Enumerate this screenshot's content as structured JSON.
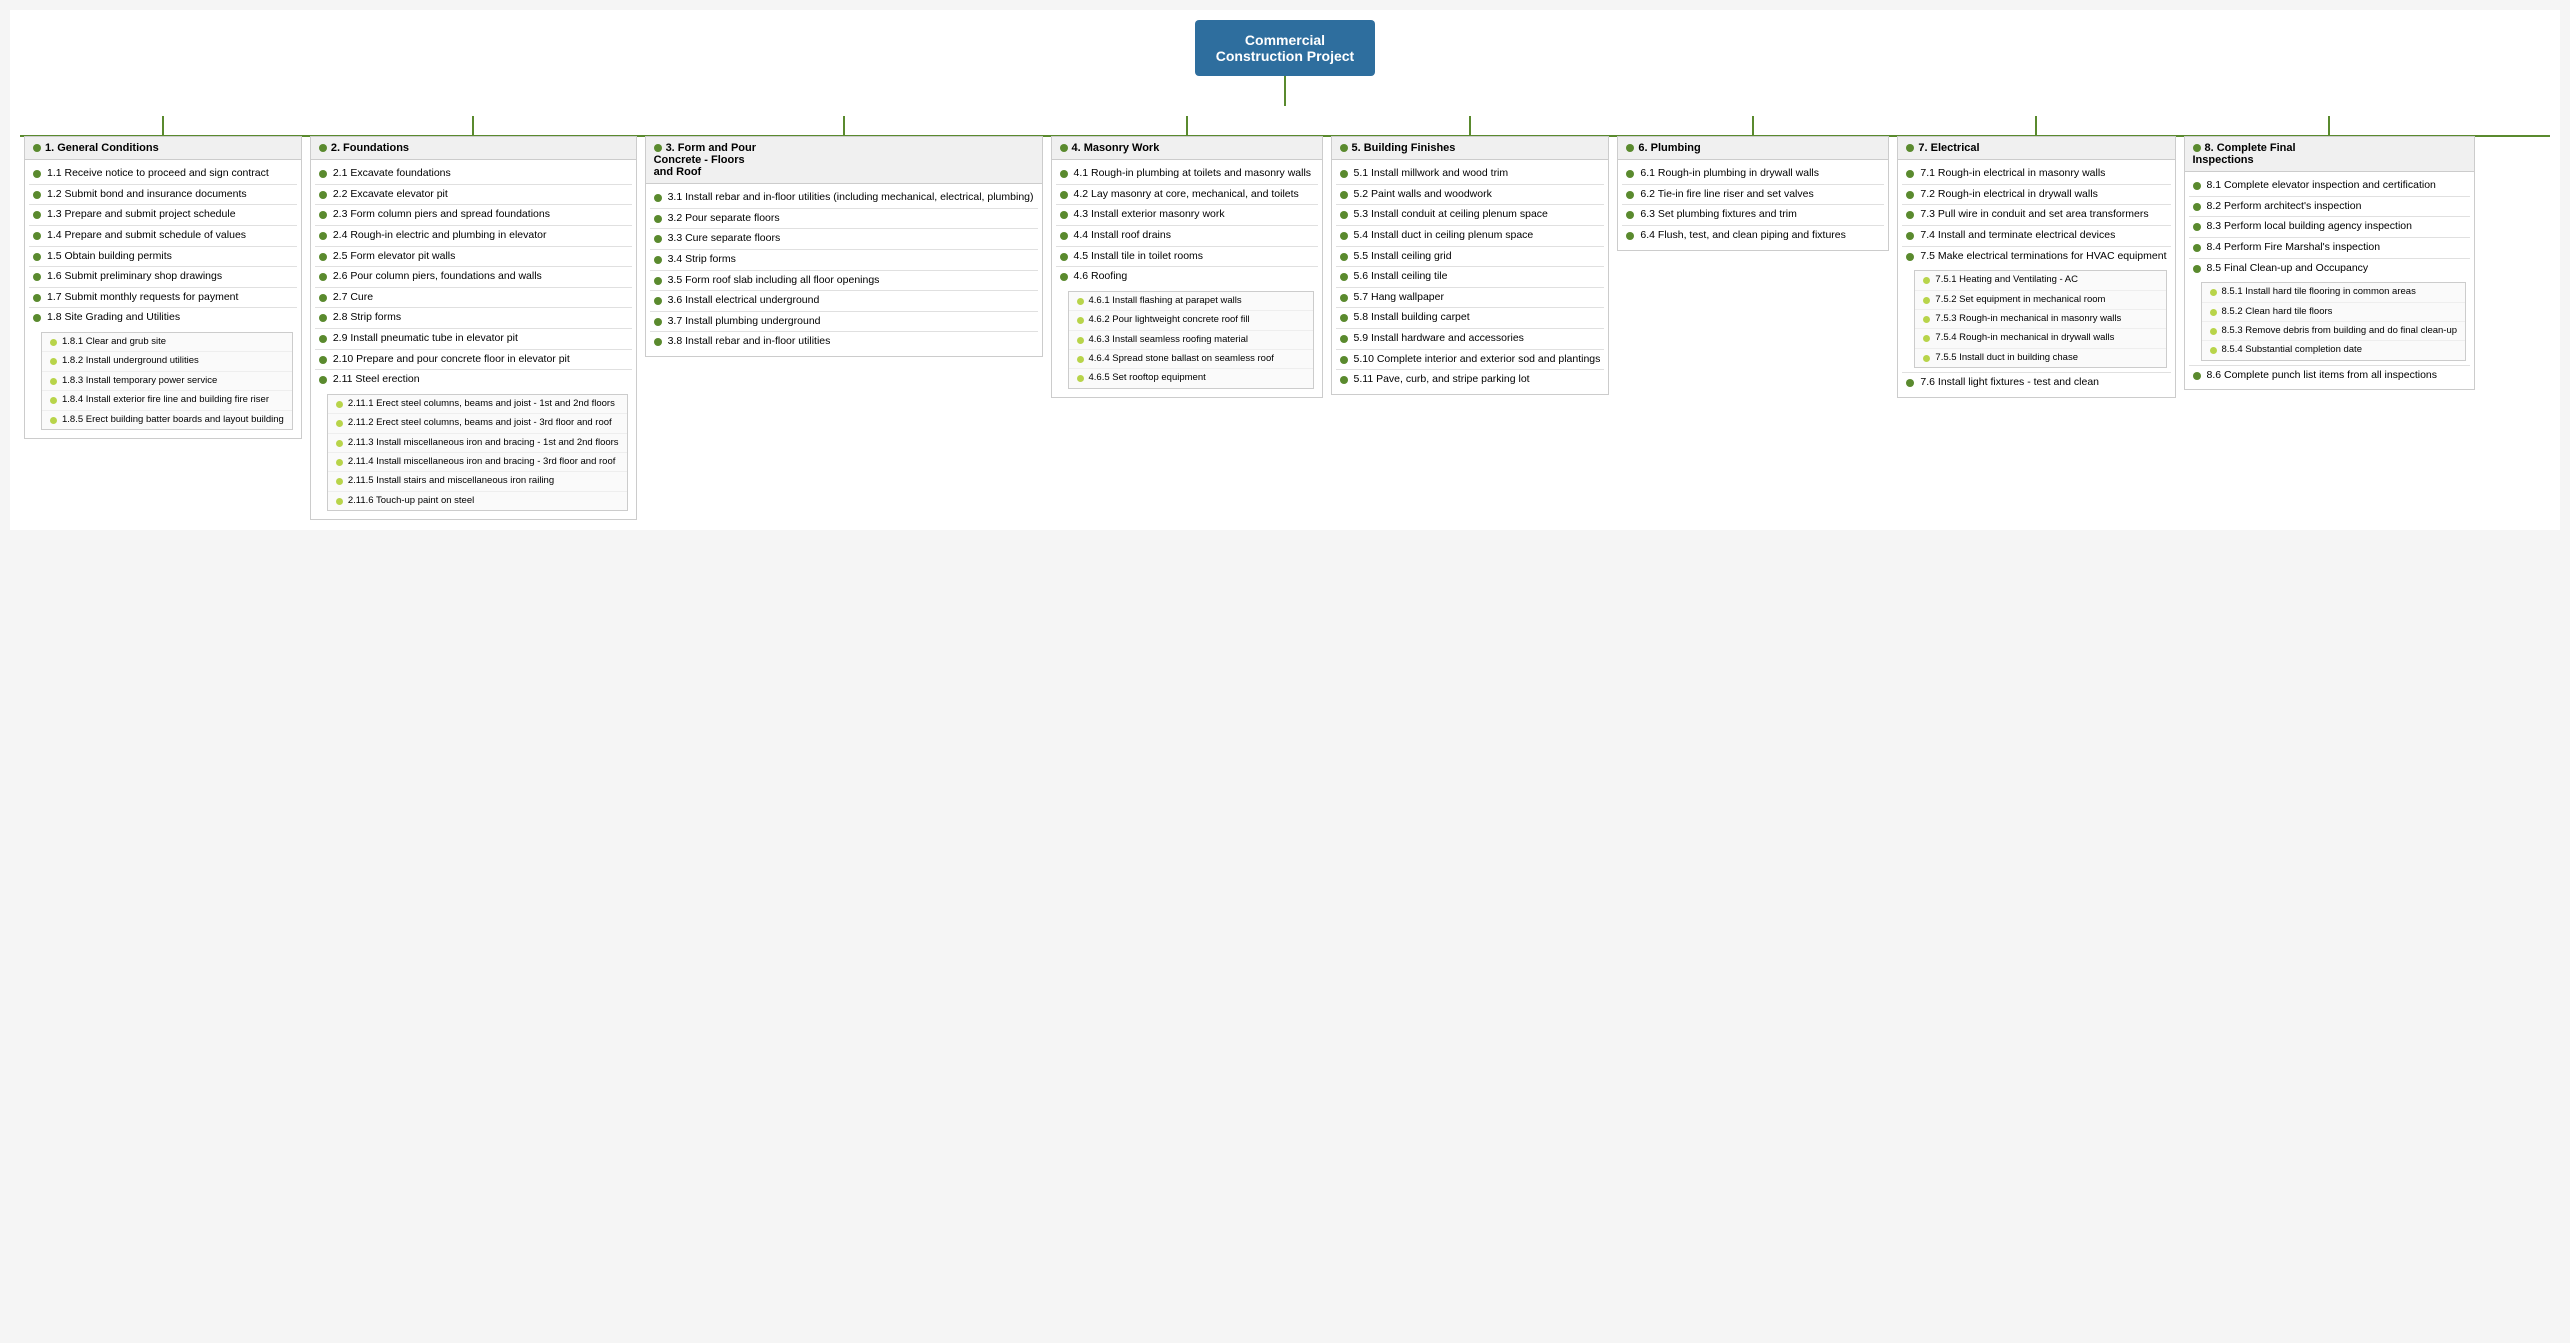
{
  "title": "Commercial\nConstruction Project",
  "columns": [
    {
      "id": "col1",
      "header": "1.  General Conditions",
      "items": [
        {
          "id": "1.1",
          "text": "1.1  Receive notice to proceed and sign contract"
        },
        {
          "id": "1.2",
          "text": "1.2   Submit bond and insurance documents"
        },
        {
          "id": "1.3",
          "text": "1.3  Prepare and submit project schedule"
        },
        {
          "id": "1.4",
          "text": "1.4  Prepare and submit schedule of values"
        },
        {
          "id": "1.5",
          "text": "1.5  Obtain building permits"
        },
        {
          "id": "1.6",
          "text": "1.6  Submit preliminary shop drawings"
        },
        {
          "id": "1.7",
          "text": "1.7  Submit monthly requests for payment"
        },
        {
          "id": "1.8",
          "text": "1.8  Site Grading and Utilities",
          "subitems": [
            {
              "id": "1.8.1",
              "text": "1.8.1  Clear and grub site"
            },
            {
              "id": "1.8.2",
              "text": "1.8.2  Install underground utilities"
            },
            {
              "id": "1.8.3",
              "text": "1.8.3  Install temporary power service"
            },
            {
              "id": "1.8.4",
              "text": "1.8.4  Install exterior fire line and building fire riser"
            },
            {
              "id": "1.8.5",
              "text": "1.8.5  Erect building batter boards and layout building"
            }
          ]
        }
      ]
    },
    {
      "id": "col2",
      "header": "2.  Foundations",
      "items": [
        {
          "id": "2.1",
          "text": "2.1  Excavate foundations"
        },
        {
          "id": "2.2",
          "text": "2.2  Excavate elevator pit"
        },
        {
          "id": "2.3",
          "text": "2.3  Form column piers and spread foundations"
        },
        {
          "id": "2.4",
          "text": "2.4  Rough-in electric and plumbing in elevator"
        },
        {
          "id": "2.5",
          "text": "2.5  Form elevator pit walls"
        },
        {
          "id": "2.6",
          "text": "2.6  Pour column piers, foundations and walls"
        },
        {
          "id": "2.7",
          "text": "2.7  Cure"
        },
        {
          "id": "2.8",
          "text": "2.8  Strip forms"
        },
        {
          "id": "2.9",
          "text": "2.9  Install pneumatic tube in elevator pit"
        },
        {
          "id": "2.10",
          "text": "2.10  Prepare and pour concrete floor in elevator pit"
        },
        {
          "id": "2.11",
          "text": "2.11  Steel erection",
          "subitems": [
            {
              "id": "2.11.1",
              "text": "2.11.1  Erect steel columns, beams and joist - 1st and 2nd floors"
            },
            {
              "id": "2.11.2",
              "text": "2.11.2  Erect steel columns, beams and joist - 3rd floor and roof"
            },
            {
              "id": "2.11.3",
              "text": "2.11.3  Install miscellaneous iron and bracing - 1st and 2nd floors"
            },
            {
              "id": "2.11.4",
              "text": "2.11.4  Install miscellaneous iron and bracing - 3rd floor and roof"
            },
            {
              "id": "2.11.5",
              "text": "2.11.5  Install stairs and miscellaneous iron railing"
            },
            {
              "id": "2.11.6",
              "text": "2.11.6  Touch-up paint on steel"
            }
          ]
        }
      ]
    },
    {
      "id": "col3",
      "header": "3.  Form and Pour\nConcrete - Floors\nand Roof",
      "items": [
        {
          "id": "3.1",
          "text": "3.1  Install rebar and in-floor utilities (including mechanical, electrical, plumbing)"
        },
        {
          "id": "3.2",
          "text": "3.2  Pour separate floors"
        },
        {
          "id": "3.3",
          "text": "3.3  Cure separate floors"
        },
        {
          "id": "3.4",
          "text": "3.4  Strip forms"
        },
        {
          "id": "3.5",
          "text": "3.5  Form roof slab including all floor openings"
        },
        {
          "id": "3.6",
          "text": "3.6  Install electrical underground"
        },
        {
          "id": "3.7",
          "text": "3.7  Install plumbing underground"
        },
        {
          "id": "3.8",
          "text": "3.8  Install rebar and in-floor utilities"
        }
      ]
    },
    {
      "id": "col4",
      "header": "4.  Masonry Work",
      "items": [
        {
          "id": "4.1",
          "text": "4.1  Rough-in plumbing at toilets and masonry walls"
        },
        {
          "id": "4.2",
          "text": "4.2  Lay masonry at core, mechanical, and toilets"
        },
        {
          "id": "4.3",
          "text": "4.3  Install exterior masonry work"
        },
        {
          "id": "4.4",
          "text": "4.4  Install roof drains"
        },
        {
          "id": "4.5",
          "text": "4.5  Install tile in toilet rooms"
        },
        {
          "id": "4.6",
          "text": "4.6  Roofing",
          "subitems": [
            {
              "id": "4.6.1",
              "text": "4.6.1  Install flashing at parapet walls"
            },
            {
              "id": "4.6.2",
              "text": "4.6.2  Pour lightweight concrete roof fill"
            },
            {
              "id": "4.6.3",
              "text": "4.6.3  Install seamless roofing material"
            },
            {
              "id": "4.6.4",
              "text": "4.6.4  Spread stone ballast on seamless roof"
            },
            {
              "id": "4.6.5",
              "text": "4.6.5  Set rooftop equipment"
            }
          ]
        }
      ]
    },
    {
      "id": "col5",
      "header": "5.  Building Finishes",
      "items": [
        {
          "id": "5.1",
          "text": "5.1  Install millwork and wood trim"
        },
        {
          "id": "5.2",
          "text": "5.2  Paint walls and woodwork"
        },
        {
          "id": "5.3",
          "text": "5.3  Install conduit at ceiling plenum space"
        },
        {
          "id": "5.4",
          "text": "5.4  Install duct in ceiling plenum space"
        },
        {
          "id": "5.5",
          "text": "5.5  Install ceiling grid"
        },
        {
          "id": "5.6",
          "text": "5.6  Install ceiling tile"
        },
        {
          "id": "5.7",
          "text": "5.7  Hang wallpaper"
        },
        {
          "id": "5.8",
          "text": "5.8  Install building carpet"
        },
        {
          "id": "5.9",
          "text": "5.9  Install hardware and accessories"
        },
        {
          "id": "5.10",
          "text": "5.10  Complete interior and exterior sod and plantings"
        },
        {
          "id": "5.11",
          "text": "5.11  Pave, curb, and stripe parking lot"
        }
      ]
    },
    {
      "id": "col6",
      "header": "6.  Plumbing",
      "items": [
        {
          "id": "6.1",
          "text": "6.1  Rough-in plumbing in drywall walls"
        },
        {
          "id": "6.2",
          "text": "6.2  Tie-in fire line riser and set valves"
        },
        {
          "id": "6.3",
          "text": "6.3  Set plumbing fixtures and trim"
        },
        {
          "id": "6.4",
          "text": "6.4  Flush, test, and clean piping and fixtures"
        }
      ]
    },
    {
      "id": "col7",
      "header": "7.  Electrical",
      "items": [
        {
          "id": "7.1",
          "text": "7.1  Rough-in electrical in masonry walls"
        },
        {
          "id": "7.2",
          "text": "7.2  Rough-in electrical in drywall walls"
        },
        {
          "id": "7.3",
          "text": "7.3  Pull wire in conduit and set area transformers"
        },
        {
          "id": "7.4",
          "text": "7.4  Install and terminate electrical devices"
        },
        {
          "id": "7.5",
          "text": "7.5  Make electrical terminations for HVAC equipment",
          "subitems": [
            {
              "id": "7.5.1",
              "text": "7.5.1  Heating and Ventilating - AC"
            },
            {
              "id": "7.5.2",
              "text": "7.5.2  Set equipment in mechanical room"
            },
            {
              "id": "7.5.3",
              "text": "7.5.3  Rough-in mechanical in masonry walls"
            },
            {
              "id": "7.5.4",
              "text": "7.5.4  Rough-in mechanical in drywall walls"
            },
            {
              "id": "7.5.5",
              "text": "7.5.5  Install duct in building chase"
            }
          ]
        },
        {
          "id": "7.6",
          "text": "7.6  Install light fixtures - test and clean"
        }
      ]
    },
    {
      "id": "col8",
      "header": "8.  Complete Final\nInspections",
      "items": [
        {
          "id": "8.1",
          "text": "8.1  Complete elevator inspection and certification"
        },
        {
          "id": "8.2",
          "text": "8.2  Perform architect's inspection"
        },
        {
          "id": "8.3",
          "text": "8.3  Perform local building agency inspection"
        },
        {
          "id": "8.4",
          "text": "8.4  Perform Fire Marshal's inspection"
        },
        {
          "id": "8.5",
          "text": "8.5  Final Clean-up and Occupancy",
          "subitems": [
            {
              "id": "8.5.1",
              "text": "8.5.1  Install hard tile flooring in common areas"
            },
            {
              "id": "8.5.2",
              "text": "8.5.2  Clean hard tile floors"
            },
            {
              "id": "8.5.3",
              "text": "8.5.3  Remove debris from building and do final clean-up"
            },
            {
              "id": "8.5.4",
              "text": "8.5.4  Substantial completion date"
            }
          ]
        },
        {
          "id": "8.6",
          "text": "8.6  Complete punch list items from all inspections"
        }
      ]
    }
  ]
}
